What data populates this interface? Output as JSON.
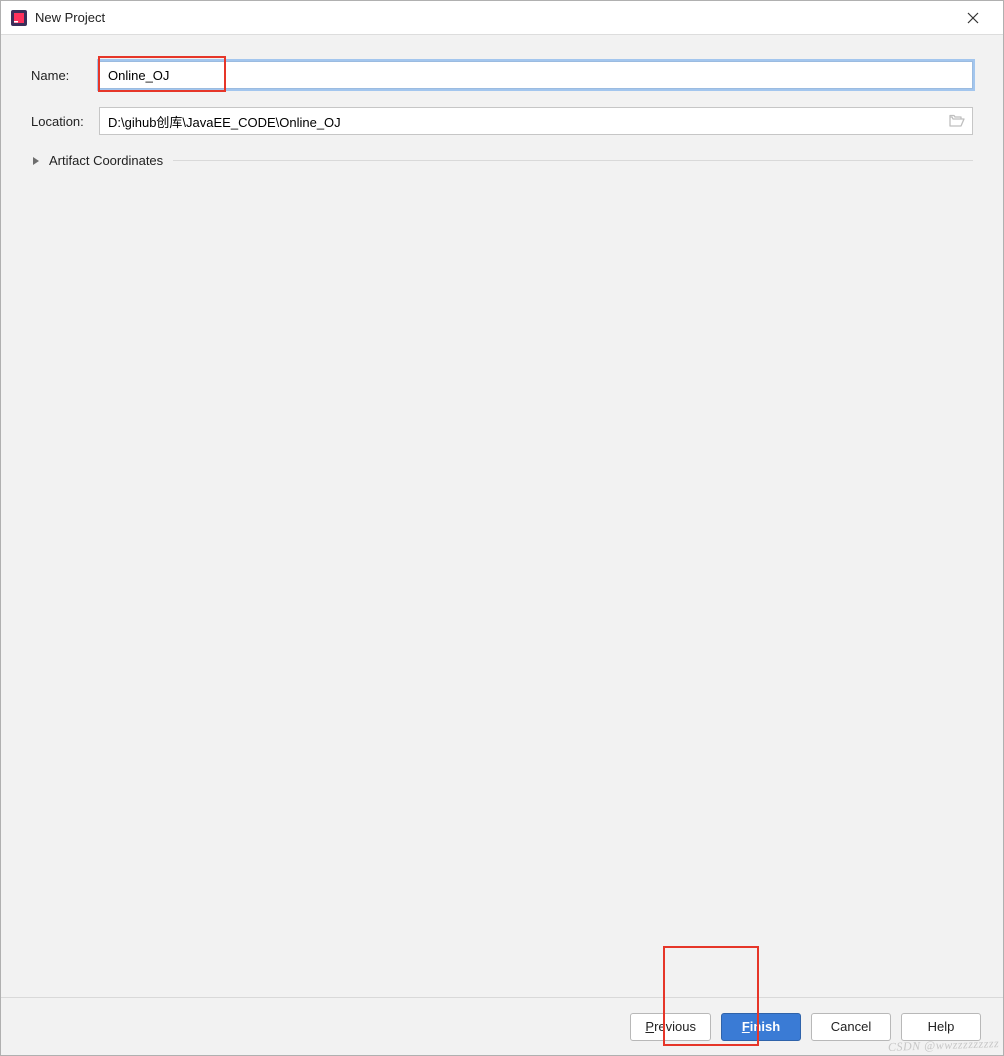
{
  "window": {
    "title": "New Project"
  },
  "form": {
    "name_label": "Name:",
    "name_value": "Online_OJ",
    "location_label": "Location:",
    "location_value": "D:\\gihub创库\\JavaEE_CODE\\Online_OJ",
    "artifact_label": "Artifact Coordinates"
  },
  "footer": {
    "previous_label": "revious",
    "previous_mn": "P",
    "finish_label": "inish",
    "finish_mn": "F",
    "cancel_label": "Cancel",
    "help_label": "Help"
  },
  "watermark": "CSDN @wwzzzzzzzzz"
}
